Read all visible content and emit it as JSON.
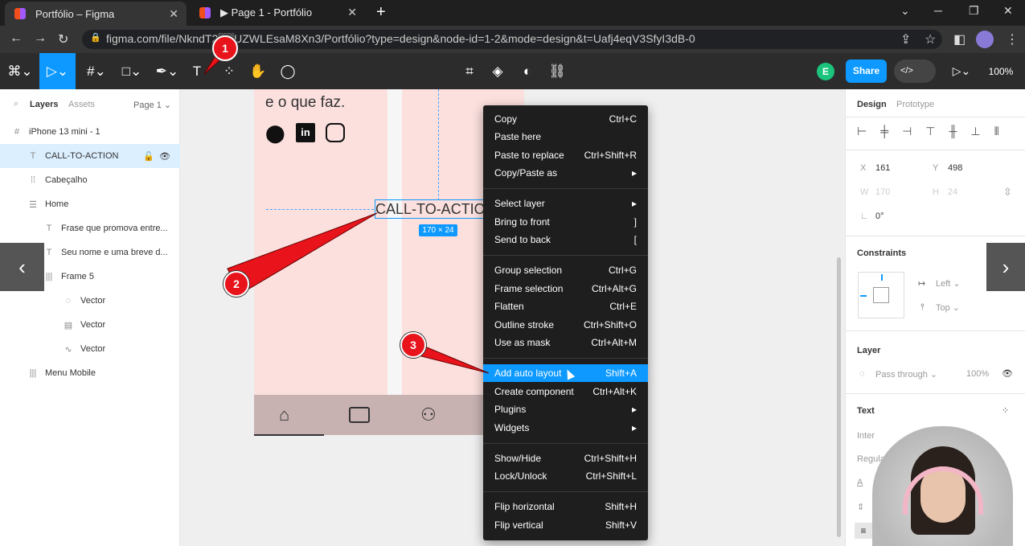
{
  "browser": {
    "tabs": [
      {
        "title": "Portfólio – Figma",
        "close": "✕"
      },
      {
        "title": "▶ Page 1 - Portfólio",
        "close": "✕"
      }
    ],
    "new_tab": "+",
    "url": "figma.com/file/NkndT2▒▒UZWLEsaM8Xn3/Portfólio?type=design&node-id=1-2&mode=design&t=Uafj4eqV3SfyI3dB-0",
    "controls": {
      "min": "─",
      "max": "❐",
      "close": "✕",
      "chevron": "⌄"
    }
  },
  "toolbar": {
    "share_label": "Share",
    "zoom_label": "100%",
    "avatar_initial": "E",
    "code_label": "</>"
  },
  "left_panel": {
    "tabs": [
      "Layers",
      "Assets"
    ],
    "page": "Page 1 ⌄",
    "layers": [
      {
        "name": "iPhone 13 mini - 1",
        "icon": "#"
      },
      {
        "name": "CALL-TO-ACTION",
        "icon": "T"
      },
      {
        "name": "Cabeçalho",
        "icon": "⁞⁞"
      },
      {
        "name": "Home",
        "icon": "☰"
      },
      {
        "name": "Frase que promova entre...",
        "icon": "T"
      },
      {
        "name": "Seu nome e uma breve d...",
        "icon": "T"
      },
      {
        "name": "Frame 5",
        "icon": "|||"
      },
      {
        "name": "Vector",
        "icon": "◌"
      },
      {
        "name": "Vector",
        "icon": "▤"
      },
      {
        "name": "Vector",
        "icon": "∿"
      },
      {
        "name": "Menu Mobile",
        "icon": "|||"
      }
    ]
  },
  "canvas": {
    "text_top": "e o que faz.",
    "selected_text": "CALL-TO-ACTIO",
    "size_badge": "170 × 24"
  },
  "context_menu": [
    {
      "label": "Copy",
      "shortcut": "Ctrl+C"
    },
    {
      "label": "Paste here",
      "shortcut": ""
    },
    {
      "label": "Paste to replace",
      "shortcut": "Ctrl+Shift+R"
    },
    {
      "label": "Copy/Paste as",
      "shortcut": "▸"
    },
    {
      "label": "Select layer",
      "shortcut": "▸"
    },
    {
      "label": "Bring to front",
      "shortcut": "]"
    },
    {
      "label": "Send to back",
      "shortcut": "["
    },
    {
      "label": "Group selection",
      "shortcut": "Ctrl+G"
    },
    {
      "label": "Frame selection",
      "shortcut": "Ctrl+Alt+G"
    },
    {
      "label": "Flatten",
      "shortcut": "Ctrl+E"
    },
    {
      "label": "Outline stroke",
      "shortcut": "Ctrl+Shift+O"
    },
    {
      "label": "Use as mask",
      "shortcut": "Ctrl+Alt+M"
    },
    {
      "label": "Add auto layout",
      "shortcut": "Shift+A"
    },
    {
      "label": "Create component",
      "shortcut": "Ctrl+Alt+K"
    },
    {
      "label": "Plugins",
      "shortcut": "▸"
    },
    {
      "label": "Widgets",
      "shortcut": "▸"
    },
    {
      "label": "Show/Hide",
      "shortcut": "Ctrl+Shift+H"
    },
    {
      "label": "Lock/Unlock",
      "shortcut": "Ctrl+Shift+L"
    },
    {
      "label": "Flip horizontal",
      "shortcut": "Shift+H"
    },
    {
      "label": "Flip vertical",
      "shortcut": "Shift+V"
    }
  ],
  "right_panel": {
    "tabs": [
      "Design",
      "Prototype"
    ],
    "x_label": "X",
    "x_value": "161",
    "y_label": "Y",
    "y_value": "498",
    "w_label": "W",
    "w_value": "170",
    "h_label": "H",
    "h_value": "24",
    "rotation": "0°",
    "constraints_title": "Constraints",
    "constraint_h": "Left ⌄",
    "constraint_v": "Top ⌄",
    "layer_title": "Layer",
    "blend": "Pass through ⌄",
    "opacity": "100%",
    "text_title": "Text",
    "font_family": "Inter",
    "font_weight": "Regula"
  },
  "annotations": {
    "badge1": "1",
    "badge2": "2",
    "badge3": "3"
  },
  "nav_arrows": {
    "left": "‹",
    "right": "›"
  },
  "colors": {
    "accent": "#0d99ff",
    "annotation": "#e8131b",
    "frame_pink": "#fbe0de"
  }
}
